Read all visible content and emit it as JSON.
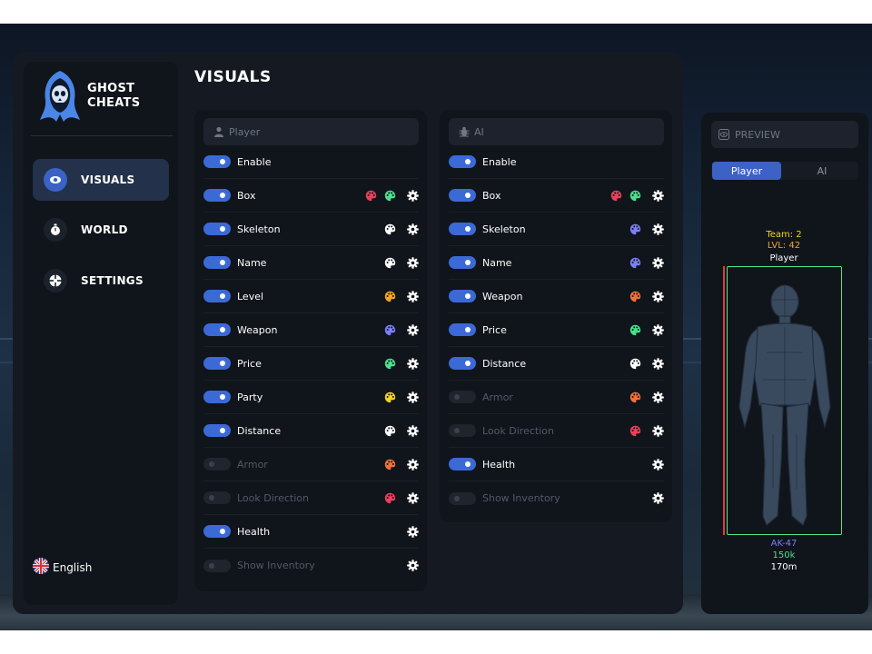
{
  "brand": {
    "line1": "GHOST",
    "line2": "CHEATS"
  },
  "nav": [
    {
      "label": "VISUALS",
      "icon": "eye-icon",
      "active": true
    },
    {
      "label": "WORLD",
      "icon": "stopwatch-icon",
      "active": false
    },
    {
      "label": "SETTINGS",
      "icon": "crosshair-icon",
      "active": false
    }
  ],
  "language": {
    "label": "English",
    "icon": "uk-flag-icon"
  },
  "page_title": "VISUALS",
  "player": {
    "header": "Player",
    "rows": [
      {
        "label": "Enable",
        "on": true,
        "palettes": []
      },
      {
        "label": "Box",
        "on": true,
        "palettes": [
          "#e8405a",
          "#48e08c"
        ]
      },
      {
        "label": "Skeleton",
        "on": true,
        "palettes": [
          "#ffffff"
        ]
      },
      {
        "label": "Name",
        "on": true,
        "palettes": [
          "#ffffff"
        ]
      },
      {
        "label": "Level",
        "on": true,
        "palettes": [
          "#f5a623"
        ]
      },
      {
        "label": "Weapon",
        "on": true,
        "palettes": [
          "#7b7ff5"
        ]
      },
      {
        "label": "Price",
        "on": true,
        "palettes": [
          "#48e08c"
        ]
      },
      {
        "label": "Party",
        "on": true,
        "palettes": [
          "#f5d323"
        ]
      },
      {
        "label": "Distance",
        "on": true,
        "palettes": [
          "#ffffff"
        ]
      },
      {
        "label": "Armor",
        "on": false,
        "palettes": [
          "#f0703a"
        ]
      },
      {
        "label": "Look Direction",
        "on": false,
        "palettes": [
          "#e8405a"
        ]
      },
      {
        "label": "Health",
        "on": true,
        "palettes": []
      },
      {
        "label": "Show Inventory",
        "on": false,
        "palettes": []
      }
    ]
  },
  "ai": {
    "header": "AI",
    "rows": [
      {
        "label": "Enable",
        "on": true,
        "palettes": []
      },
      {
        "label": "Box",
        "on": true,
        "palettes": [
          "#e8405a",
          "#48e08c"
        ]
      },
      {
        "label": "Skeleton",
        "on": true,
        "palettes": [
          "#7b7ff5"
        ]
      },
      {
        "label": "Name",
        "on": true,
        "palettes": [
          "#7b7ff5"
        ]
      },
      {
        "label": "Weapon",
        "on": true,
        "palettes": [
          "#f0703a"
        ]
      },
      {
        "label": "Price",
        "on": true,
        "palettes": [
          "#48e08c"
        ]
      },
      {
        "label": "Distance",
        "on": true,
        "palettes": [
          "#ffffff"
        ]
      },
      {
        "label": "Armor",
        "on": false,
        "palettes": [
          "#f0703a"
        ]
      },
      {
        "label": "Look Direction",
        "on": false,
        "palettes": [
          "#e8405a"
        ]
      },
      {
        "label": "Health",
        "on": true,
        "palettes": []
      },
      {
        "label": "Show Inventory",
        "on": false,
        "palettes": []
      }
    ]
  },
  "preview": {
    "header": "PREVIEW",
    "tabs": [
      {
        "label": "Player",
        "active": true
      },
      {
        "label": "AI",
        "active": false
      }
    ],
    "team": "Team: 2",
    "level": "LVL: 42",
    "name": "Player",
    "weapon": "AK-47",
    "price": "150k",
    "distance": "170m",
    "colors": {
      "team": "#f5d323",
      "level": "#f5a623",
      "weapon": "#7b7ff5",
      "price": "#48e08c",
      "box": "#4ee58f",
      "health": "#e23b3b"
    }
  },
  "colors": {
    "accent": "#3b62c4",
    "toggle_on": "#3b69d6",
    "panel": "#151a22",
    "card": "#10141b"
  }
}
